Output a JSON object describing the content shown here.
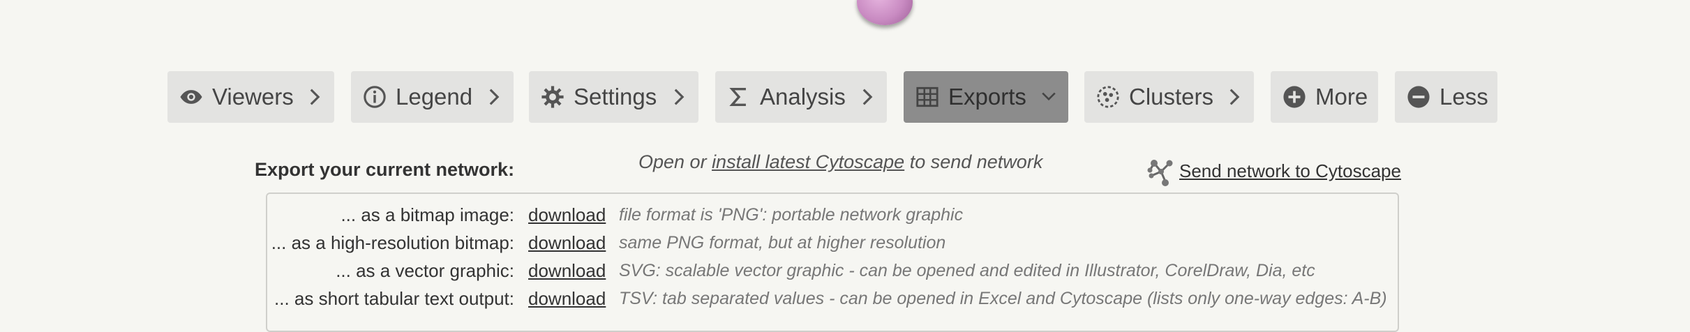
{
  "logo": {
    "icon": "network-app-logo"
  },
  "toolbar": {
    "tabs": [
      {
        "label": "Viewers",
        "icon": "eye-icon",
        "chevron": "chevron-right-icon",
        "active": false
      },
      {
        "label": "Legend",
        "icon": "info-icon",
        "chevron": "chevron-right-icon",
        "active": false
      },
      {
        "label": "Settings",
        "icon": "gear-icon",
        "chevron": "chevron-right-icon",
        "active": false
      },
      {
        "label": "Analysis",
        "icon": "sigma-icon",
        "chevron": "chevron-right-icon",
        "active": false
      },
      {
        "label": "Exports",
        "icon": "table-icon",
        "chevron": "chevron-down-icon",
        "active": true
      },
      {
        "label": "Clusters",
        "icon": "clusters-icon",
        "chevron": "chevron-right-icon",
        "active": false
      },
      {
        "label": "More",
        "icon": "plus-circle-icon",
        "active": false
      },
      {
        "label": "Less",
        "icon": "minus-circle-icon",
        "active": false
      }
    ]
  },
  "exports": {
    "title": "Export your current network:",
    "open_prefix": "Open or ",
    "open_link": "install latest Cytoscape",
    "open_suffix": " to send network",
    "send_label": "Send network to Cytoscape",
    "rows": [
      {
        "label": "... as a bitmap image:",
        "link": "download",
        "desc": "file format is 'PNG': portable network graphic"
      },
      {
        "label": "... as a high-resolution bitmap:",
        "link": "download",
        "desc": "same PNG format, but at higher resolution"
      },
      {
        "label": "... as a vector graphic:",
        "link": "download",
        "desc": "SVG: scalable vector graphic - can be opened and edited in Illustrator, CorelDraw, Dia, etc"
      },
      {
        "label": "... as short tabular text output:",
        "link": "download",
        "desc": "TSV: tab separated values - can be opened in Excel and Cytoscape (lists only one-way edges: A-B)"
      }
    ]
  },
  "colors": {
    "background": "#f6f6f2",
    "tab": "#e3e3e1",
    "tab_active": "#8c8c8c"
  }
}
